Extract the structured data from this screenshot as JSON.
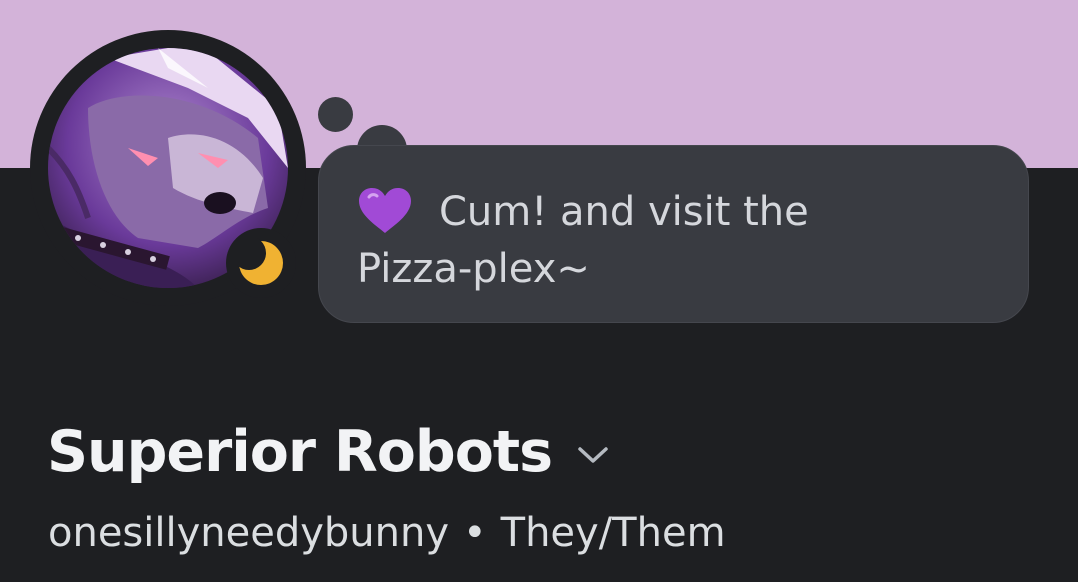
{
  "profile": {
    "banner_color": "#d3b3d9",
    "avatar_icon": "purple-wolf-avatar",
    "status_icon": "moon-idle-icon",
    "status_color": "#f0b232",
    "custom_status": {
      "emoji": "purple-heart-icon",
      "emoji_color": "#a14ad6",
      "text": "Cum! and visit the Pizza-plex~"
    },
    "display_name": "Superior Robots",
    "username": "onesillyneedybunny",
    "separator": "•",
    "pronouns": "They/Them"
  }
}
